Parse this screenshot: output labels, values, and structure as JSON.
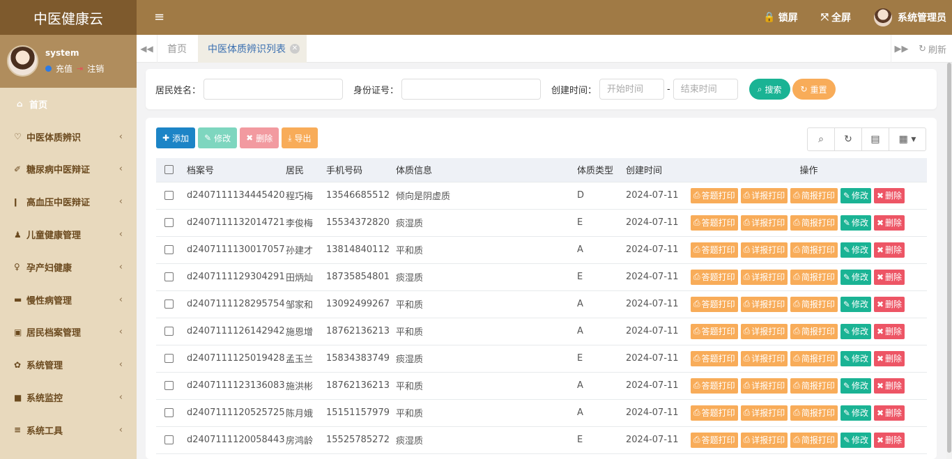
{
  "header": {
    "brand": "中医健康云",
    "menu_icon": "hamburger-icon",
    "lock_label": "锁屏",
    "fullscreen_label": "全屏",
    "user_label": "系统管理员"
  },
  "sidebar": {
    "username": "system",
    "recharge": "充值",
    "logout": "注销",
    "items": [
      {
        "label": "首页",
        "icon": "home-icon"
      },
      {
        "label": "中医体质辨识",
        "icon": "heartbeat-icon"
      },
      {
        "label": "糖尿病中医辩证",
        "icon": "syringe-icon"
      },
      {
        "label": "高血压中医辩证",
        "icon": "thermometer-icon"
      },
      {
        "label": "儿童健康管理",
        "icon": "child-icon"
      },
      {
        "label": "孕产妇健康",
        "icon": "female-icon"
      },
      {
        "label": "慢性病管理",
        "icon": "bed-icon"
      },
      {
        "label": "居民档案管理",
        "icon": "id-card-icon"
      },
      {
        "label": "系统管理",
        "icon": "gear-icon"
      },
      {
        "label": "系统监控",
        "icon": "video-icon"
      },
      {
        "label": "系统工具",
        "icon": "bars-icon"
      }
    ]
  },
  "tabs": {
    "home": "首页",
    "active": "中医体质辨识列表",
    "refresh": "刷新"
  },
  "search": {
    "name_label": "居民姓名：",
    "id_label": "身份证号：",
    "time_label": "创建时间：",
    "start_placeholder": "开始时间",
    "end_placeholder": "结束时间",
    "dash": "-",
    "search_btn": "搜索",
    "reset_btn": "重置"
  },
  "toolbar": {
    "add": "添加",
    "edit": "修改",
    "delete": "删除",
    "export": "导出"
  },
  "table": {
    "headers": [
      "档案号",
      "居民",
      "手机号码",
      "体质信息",
      "体质类型",
      "创建时间",
      "操作"
    ],
    "op_labels": {
      "answer_print": "答题打印",
      "detail_print": "详报打印",
      "brief_print": "简报打印",
      "edit": "修改",
      "delete": "删除"
    },
    "rows": [
      {
        "id": "d2407111134445420",
        "name": "程巧梅",
        "phone": "13546685512",
        "info": "倾向是阴虚质",
        "type": "D",
        "date": "2024-07-11"
      },
      {
        "id": "d2407111132014721",
        "name": "李俊梅",
        "phone": "15534372820",
        "info": "痰湿质",
        "type": "E",
        "date": "2024-07-11"
      },
      {
        "id": "d2407111130017057",
        "name": "孙建才",
        "phone": "13814840112",
        "info": "平和质",
        "type": "A",
        "date": "2024-07-11"
      },
      {
        "id": "d2407111129304291",
        "name": "田炳灿",
        "phone": "18735854801",
        "info": "痰湿质",
        "type": "E",
        "date": "2024-07-11"
      },
      {
        "id": "d2407111128295754",
        "name": "邹家和",
        "phone": "13092499267",
        "info": "平和质",
        "type": "A",
        "date": "2024-07-11"
      },
      {
        "id": "d2407111126142942",
        "name": "施恩增",
        "phone": "18762136213",
        "info": "平和质",
        "type": "A",
        "date": "2024-07-11"
      },
      {
        "id": "d2407111125019428",
        "name": "孟玉兰",
        "phone": "15834383749",
        "info": "痰湿质",
        "type": "E",
        "date": "2024-07-11"
      },
      {
        "id": "d2407111123136083",
        "name": "施洪彬",
        "phone": "18762136213",
        "info": "平和质",
        "type": "A",
        "date": "2024-07-11"
      },
      {
        "id": "d2407111120525725",
        "name": "陈月娥",
        "phone": "15151157979",
        "info": "平和质",
        "type": "A",
        "date": "2024-07-11"
      },
      {
        "id": "d2407111120058443",
        "name": "房鸿龄",
        "phone": "15525785272",
        "info": "痰湿质",
        "type": "E",
        "date": "2024-07-11"
      }
    ]
  },
  "colors": {
    "header_bg": "#a07a45",
    "brand_bg": "#7e5a2d",
    "sidebar_bg": "#e8d9bd",
    "primary_green": "#1ab394",
    "warning_orange": "#f8ac59",
    "danger_red": "#ed5565",
    "info_blue": "#1c84c6"
  }
}
